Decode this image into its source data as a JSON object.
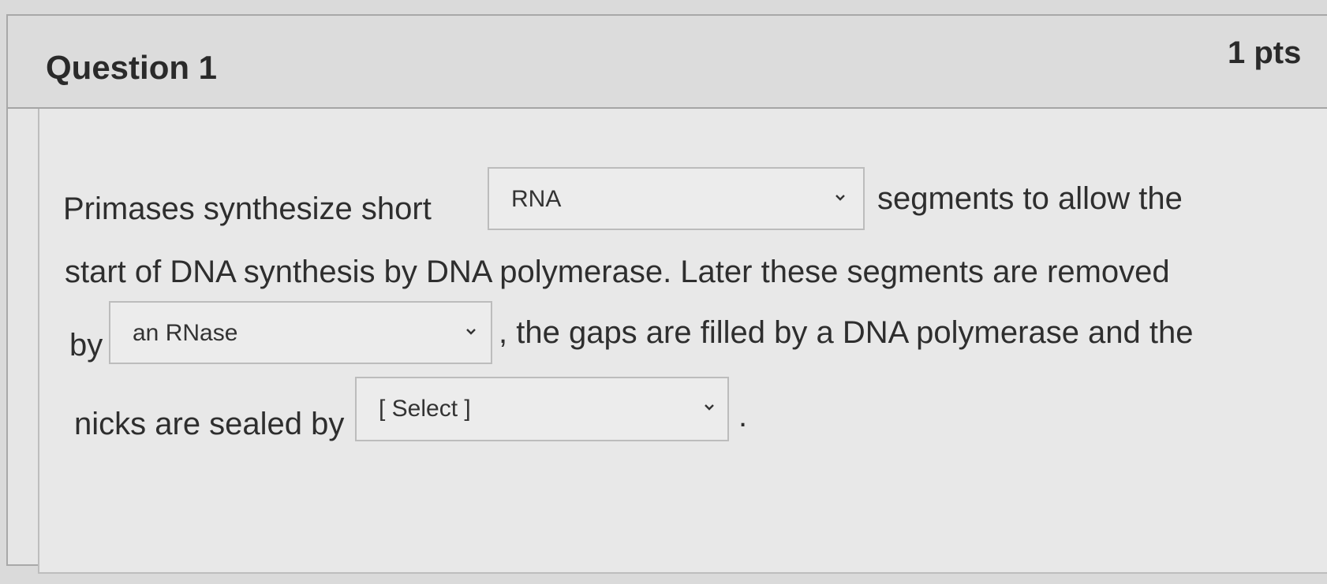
{
  "question": {
    "title": "Question 1",
    "points": "1 pts"
  },
  "body": {
    "line1_prefix": "Primases synthesize short",
    "line1_suffix": "segments to allow the",
    "line2": "start of DNA synthesis by DNA polymerase. Later these segments are removed",
    "line3_prefix": "by",
    "line3_suffix": ", the gaps are filled by a DNA polymerase and the",
    "line4_prefix": "nicks are sealed by",
    "line4_suffix": "."
  },
  "dropdowns": {
    "primer_type": {
      "selected": "RNA"
    },
    "primer_removal": {
      "selected": "an RNase"
    },
    "nick_sealer": {
      "selected": "[ Select ]"
    }
  },
  "icons": {
    "dropdown": "chevron-down-icon"
  }
}
